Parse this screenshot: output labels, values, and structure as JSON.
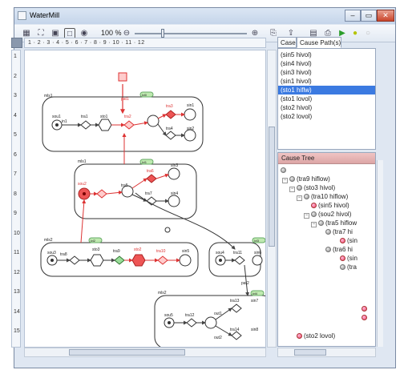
{
  "window": {
    "title": "WaterMill"
  },
  "titlebar": {
    "minimize": "–",
    "maximize": "▭",
    "close": "✕"
  },
  "toolbar": {
    "zoom": "100 %"
  },
  "ruler": {
    "h": "1 · 2 · 3 · 4 · 5 · 6 · 7 · 8 · 9 · 10 · 11 · 12",
    "v": [
      "1",
      "2",
      "3",
      "4",
      "5",
      "6",
      "7",
      "8",
      "9",
      "10",
      "11",
      "12",
      "13",
      "14",
      "15"
    ]
  },
  "tabs": [
    "Case",
    "Cause Path(s)"
  ],
  "cause_paths": [
    "(sin5 hivol)",
    "(sin4 hivol)",
    "(sin3 hivol)",
    "(sin1 hivol)",
    "(sto1 hiflw)",
    "(sto1 lovol)",
    "(sto2 hivol)",
    "(sto2 lovol)"
  ],
  "cause_tree": {
    "title": "Cause Tree",
    "nodes": [
      "(tra9 hiflow)",
      "(sto3 hivol)",
      "(tra10 hiflow)",
      "(sin5 hivol)",
      "(sou2 hivol)",
      "(tra5 hiflow",
      "(tra7 hi",
      "(sin",
      "(tra6 hi",
      "(sin",
      "(tra",
      "(sto2 lovol)"
    ]
  },
  "diagram": {
    "groups": [
      "mls1",
      "mls1",
      "mls2",
      "mls2"
    ],
    "badges": [
      "lvl0",
      "lvl1",
      "lvl2",
      "lvl3",
      "lvl4"
    ],
    "labels": [
      "sou1",
      "in1",
      "tra1",
      "sto1",
      "tra2",
      "sin1",
      "tra3",
      "sin2",
      "tra4",
      "pat1",
      "sou2",
      "tra8",
      "sto3",
      "tra5",
      "sin3",
      "tra7",
      "sin4",
      "tra6",
      "sou3",
      "tra9",
      "sto2",
      "tra10",
      "sin5",
      "sou4",
      "tra11",
      "sin6",
      "sou5",
      "tra12",
      "tra13",
      "sin7",
      "tra14",
      "sin8",
      "out1",
      "out2",
      "pat2"
    ]
  }
}
